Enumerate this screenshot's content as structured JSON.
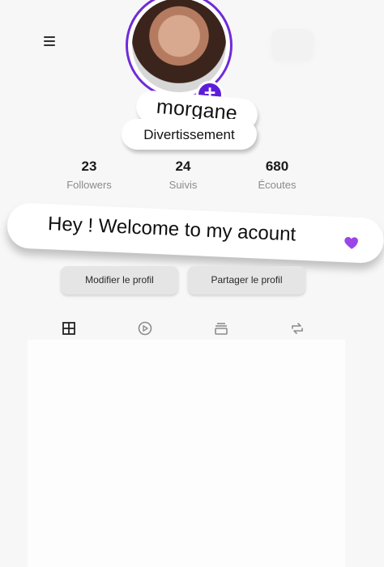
{
  "profile": {
    "username": "morgane",
    "category": "Divertissement",
    "bio": "Hey ! Welcome to my acount"
  },
  "stats": [
    {
      "value": "23",
      "label": "Followers"
    },
    {
      "value": "24",
      "label": "Suivis"
    },
    {
      "value": "680",
      "label": "Écoutes"
    }
  ],
  "actions": {
    "edit_profile": "Modifier le profil",
    "share_profile": "Partager le profil"
  },
  "tabs": [
    {
      "icon": "grid-icon"
    },
    {
      "icon": "play-circle-icon"
    },
    {
      "icon": "stack-icon"
    },
    {
      "icon": "repost-icon"
    }
  ],
  "icons": {
    "menu": "menu-icon",
    "add_avatar": "plus-icon",
    "bio_emoji": "purple-heart-icon"
  },
  "colors": {
    "accent": "#6f2bd7",
    "accent_dark": "#5d1dd8",
    "heart": "#9b45e8",
    "button_bg": "#e5e5e5",
    "muted_text": "#8b8b8b"
  }
}
